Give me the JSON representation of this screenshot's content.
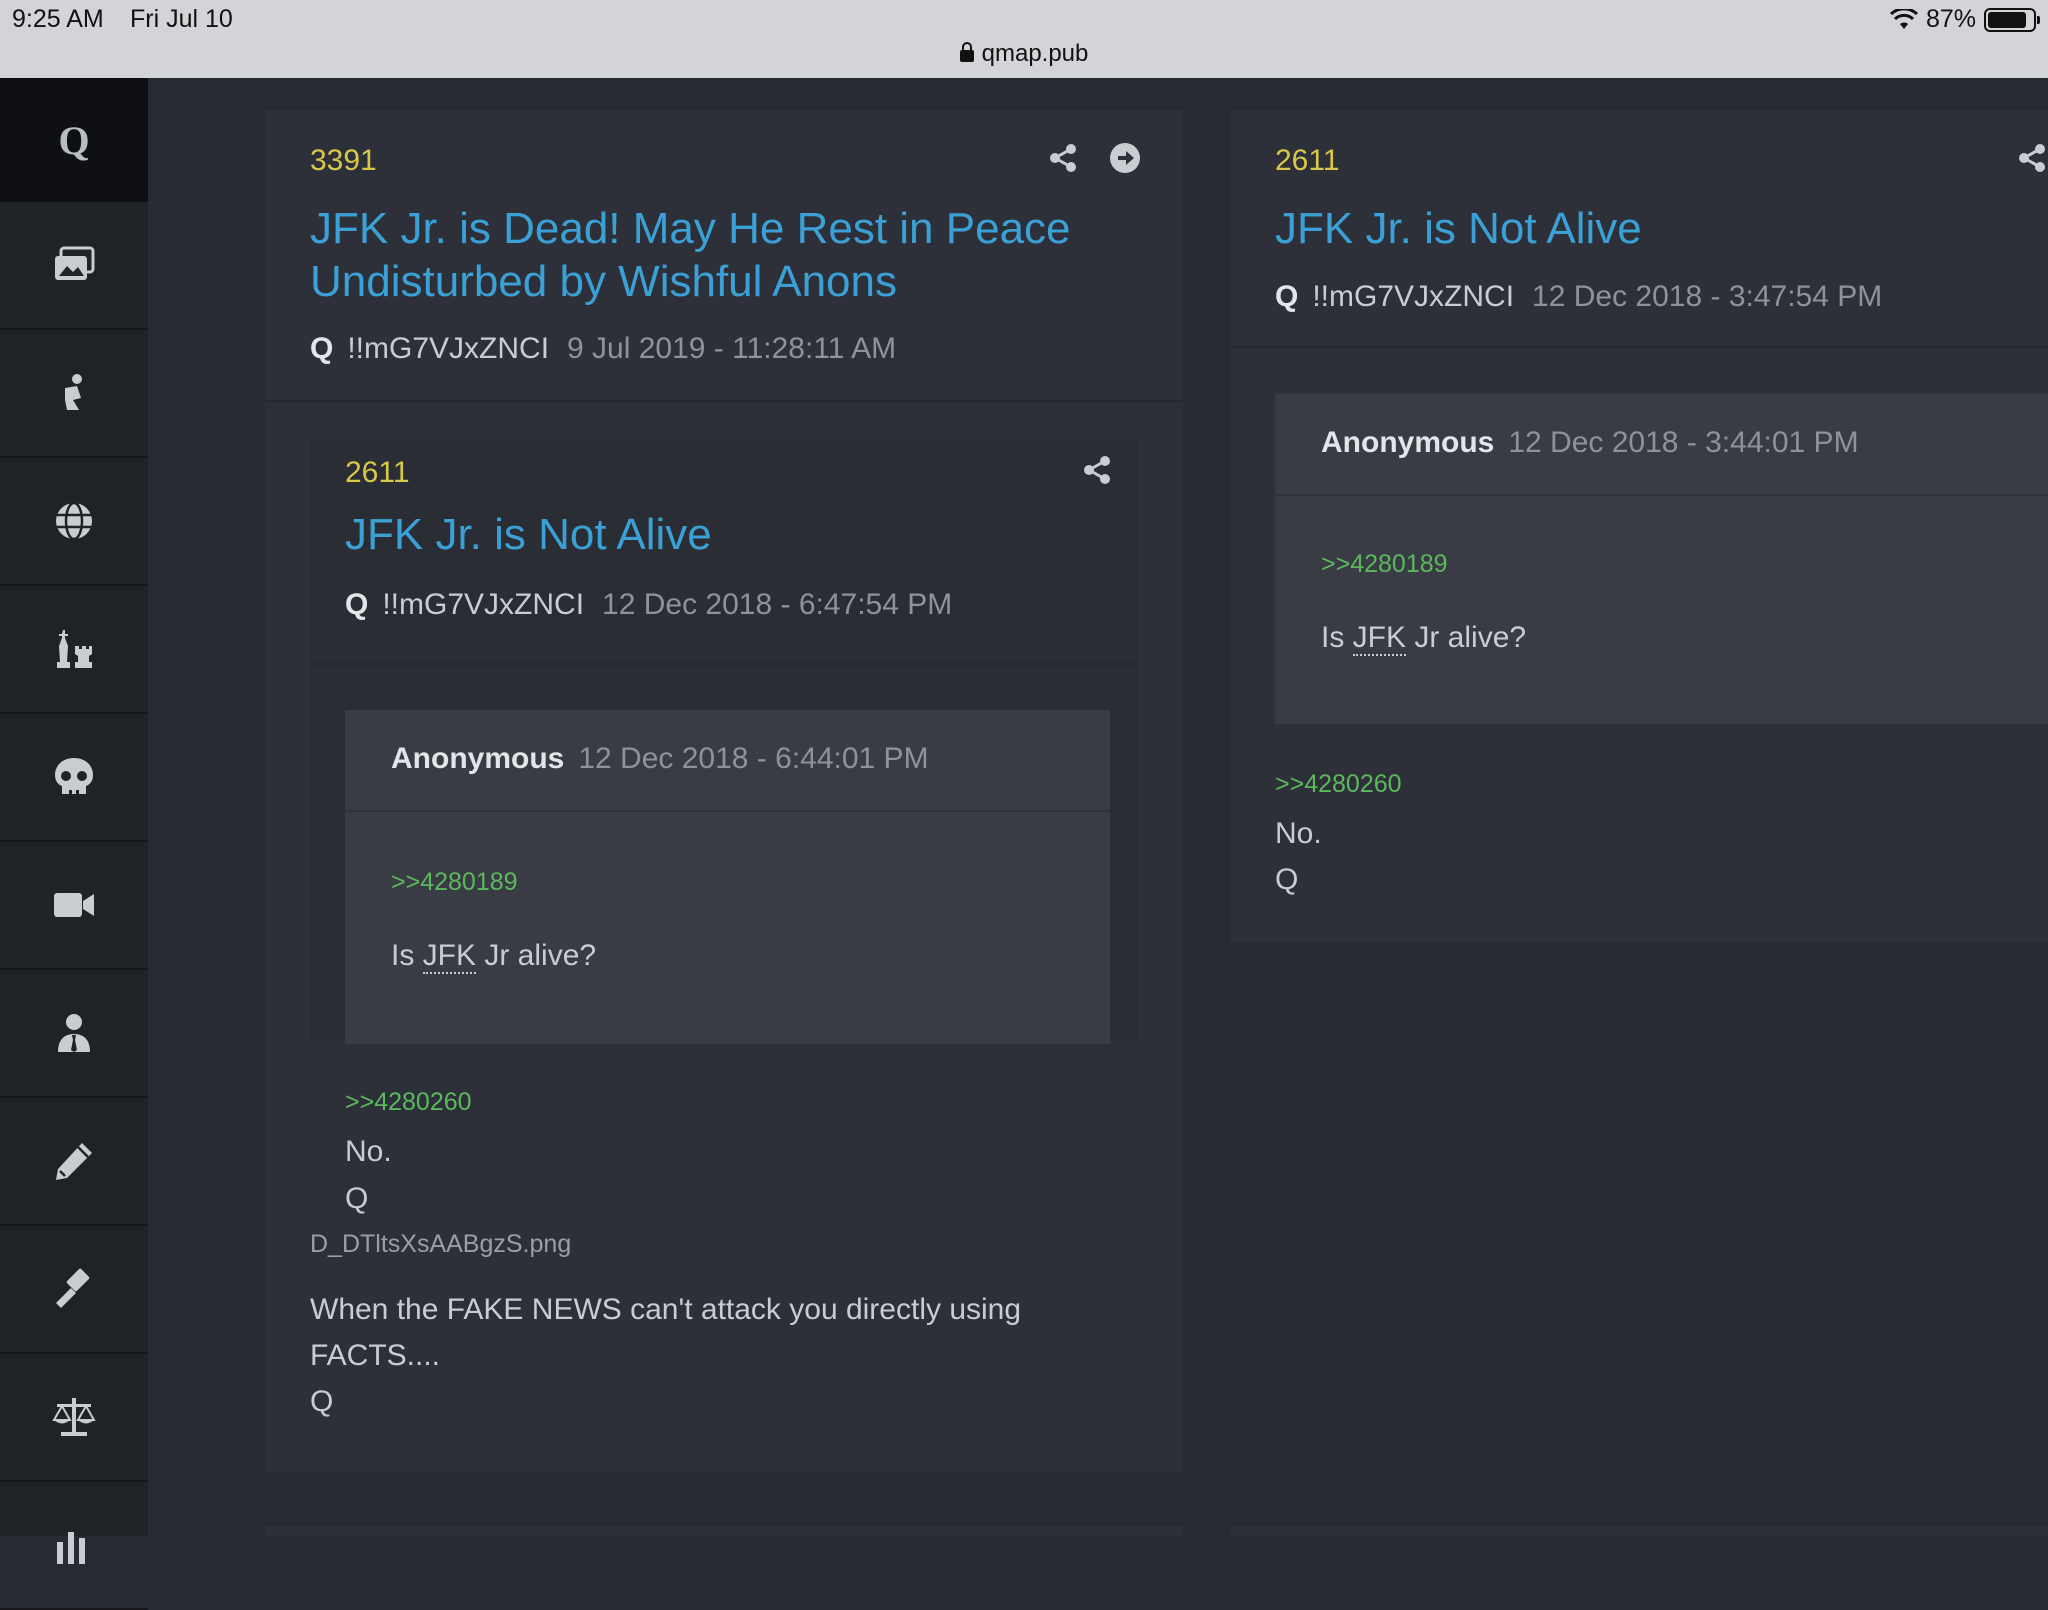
{
  "status_bar": {
    "time": "9:25 AM",
    "date": "Fri Jul 10",
    "battery": "87%",
    "battery_level": 0.87,
    "url": "qmap.pub"
  },
  "sidebar": {
    "logo": "Q",
    "items": [
      {
        "icon": "gallery-icon"
      },
      {
        "icon": "praying-icon"
      },
      {
        "icon": "globe-icon"
      },
      {
        "icon": "chess-icon"
      },
      {
        "icon": "skull-icon"
      },
      {
        "icon": "video-camera-icon"
      },
      {
        "icon": "user-tie-icon"
      },
      {
        "icon": "pencil-icon"
      },
      {
        "icon": "gavel-icon"
      },
      {
        "icon": "balance-scale-icon"
      },
      {
        "icon": "chart-icon"
      }
    ]
  },
  "post_left": {
    "number": "3391",
    "title": "JFK Jr. is Dead! May He Rest in Peace Undisturbed by Wishful Anons",
    "author": "Q",
    "tripcode": "!!mG7VJxZNCI",
    "date": "9 Jul 2019 - 11:28:11 AM",
    "quoted_post": {
      "number": "2611",
      "title": "JFK Jr. is Not Alive",
      "author": "Q",
      "tripcode": "!!mG7VJxZNCI",
      "date": "12 Dec 2018 - 6:47:54 PM",
      "anon_quote": {
        "author": "Anonymous",
        "date": "12 Dec 2018 - 6:44:01 PM",
        "reply_link": ">>4280189",
        "text_before": "Is ",
        "text_abbr": "JFK",
        "text_after": " Jr alive?"
      },
      "reply_link": ">>4280260",
      "reply_lines": [
        "No.",
        "Q"
      ]
    },
    "filename": "D_DTltsXsAABgzS.png",
    "body_lines": [
      "When the FAKE NEWS can't attack you directly using",
      "FACTS....",
      "Q"
    ]
  },
  "post_right": {
    "number": "2611",
    "title": "JFK Jr. is Not Alive",
    "author": "Q",
    "tripcode": "!!mG7VJxZNCI",
    "date": "12 Dec 2018 - 3:47:54 PM",
    "anon_quote": {
      "author": "Anonymous",
      "date": "12 Dec 2018 - 3:44:01 PM",
      "reply_link": ">>4280189",
      "text_before": "Is ",
      "text_abbr": "JFK",
      "text_after": " Jr alive?"
    },
    "reply_link": ">>4280260",
    "reply_lines": [
      "No.",
      "Q"
    ]
  },
  "colors": {
    "background": "#272a31",
    "sidebar": "#1f2227",
    "card": "#2d3038",
    "post_number": "#d7c84a",
    "title_link": "#3aa0d5",
    "reply_link": "#5cb85c"
  }
}
